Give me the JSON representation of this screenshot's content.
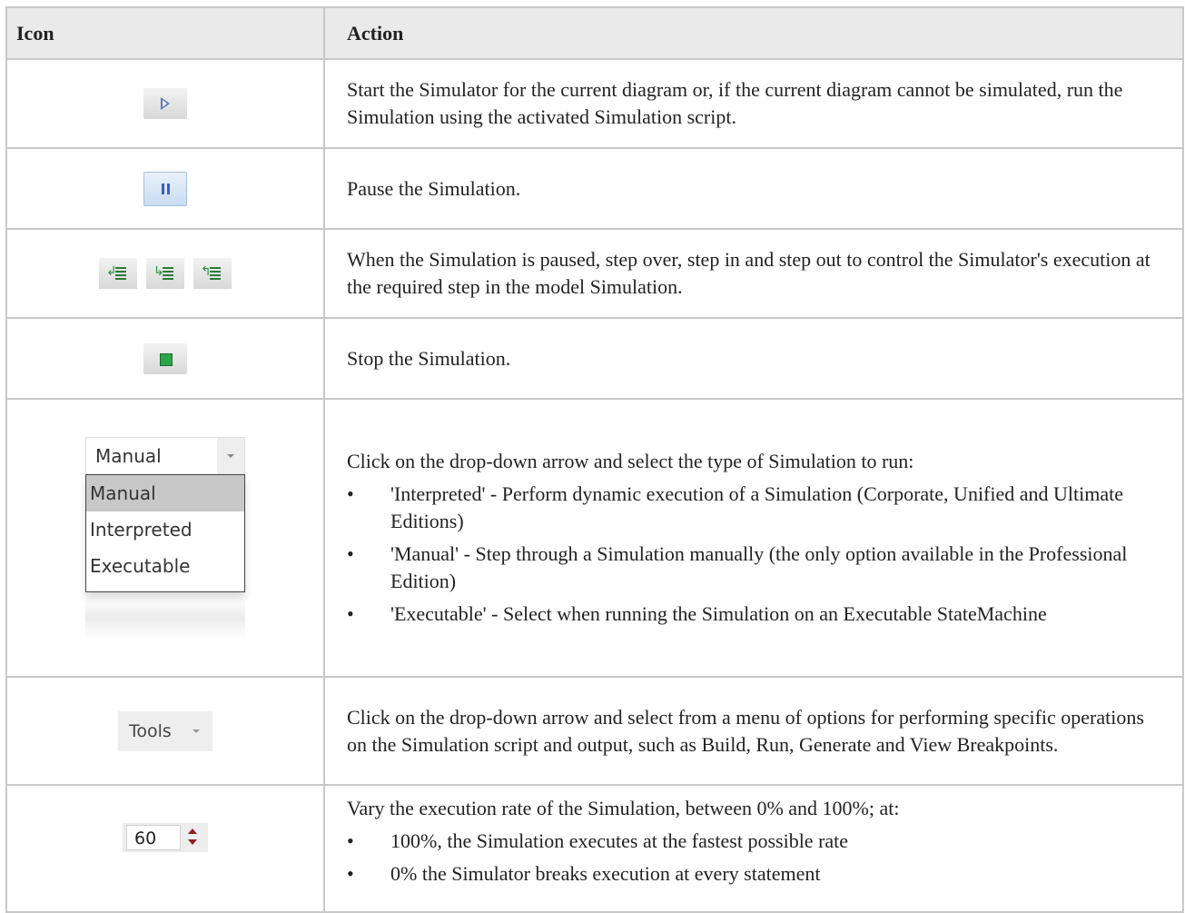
{
  "headers": {
    "icon": "Icon",
    "action": "Action"
  },
  "rows": {
    "run": {
      "icon": "run-simulation-icon",
      "text": "Start the Simulator for the current diagram or, if the current diagram cannot be simulated, run the Simulation using the activated Simulation script."
    },
    "pause": {
      "icon": "pause-icon",
      "text": "Pause the Simulation."
    },
    "step": {
      "icons": [
        "step-over-icon",
        "step-in-icon",
        "step-out-icon"
      ],
      "text": "When the Simulation is paused, step over, step in and step out to control the Simulator's execution at the required step in the model Simulation."
    },
    "stop": {
      "icon": "stop-icon",
      "text": "Stop the Simulation."
    },
    "mode": {
      "selected": "Manual",
      "options": [
        "Manual",
        "Interpreted",
        "Executable"
      ],
      "text": "Click on the drop-down arrow and select the type of Simulation to run:",
      "bullets": [
        "'Interpreted' - Perform dynamic execution of a Simulation (Corporate, Unified and Ultimate Editions)",
        "'Manual' - Step through a Simulation manually (the only option available in the Professional Edition)",
        "'Executable' - Select when running the Simulation on an Executable StateMachine"
      ]
    },
    "tools": {
      "label": "Tools",
      "text": "Click on the drop-down arrow and select from a menu of options for performing specific operations on the Simulation script and output, such as Build, Run, Generate and View Breakpoints."
    },
    "rate": {
      "value": "60",
      "text": "Vary the execution rate of the Simulation, between 0% and 100%; at:",
      "bullets": [
        "100%, the Simulation executes at the fastest possible rate",
        "0% the Simulator breaks execution at every statement"
      ]
    }
  }
}
